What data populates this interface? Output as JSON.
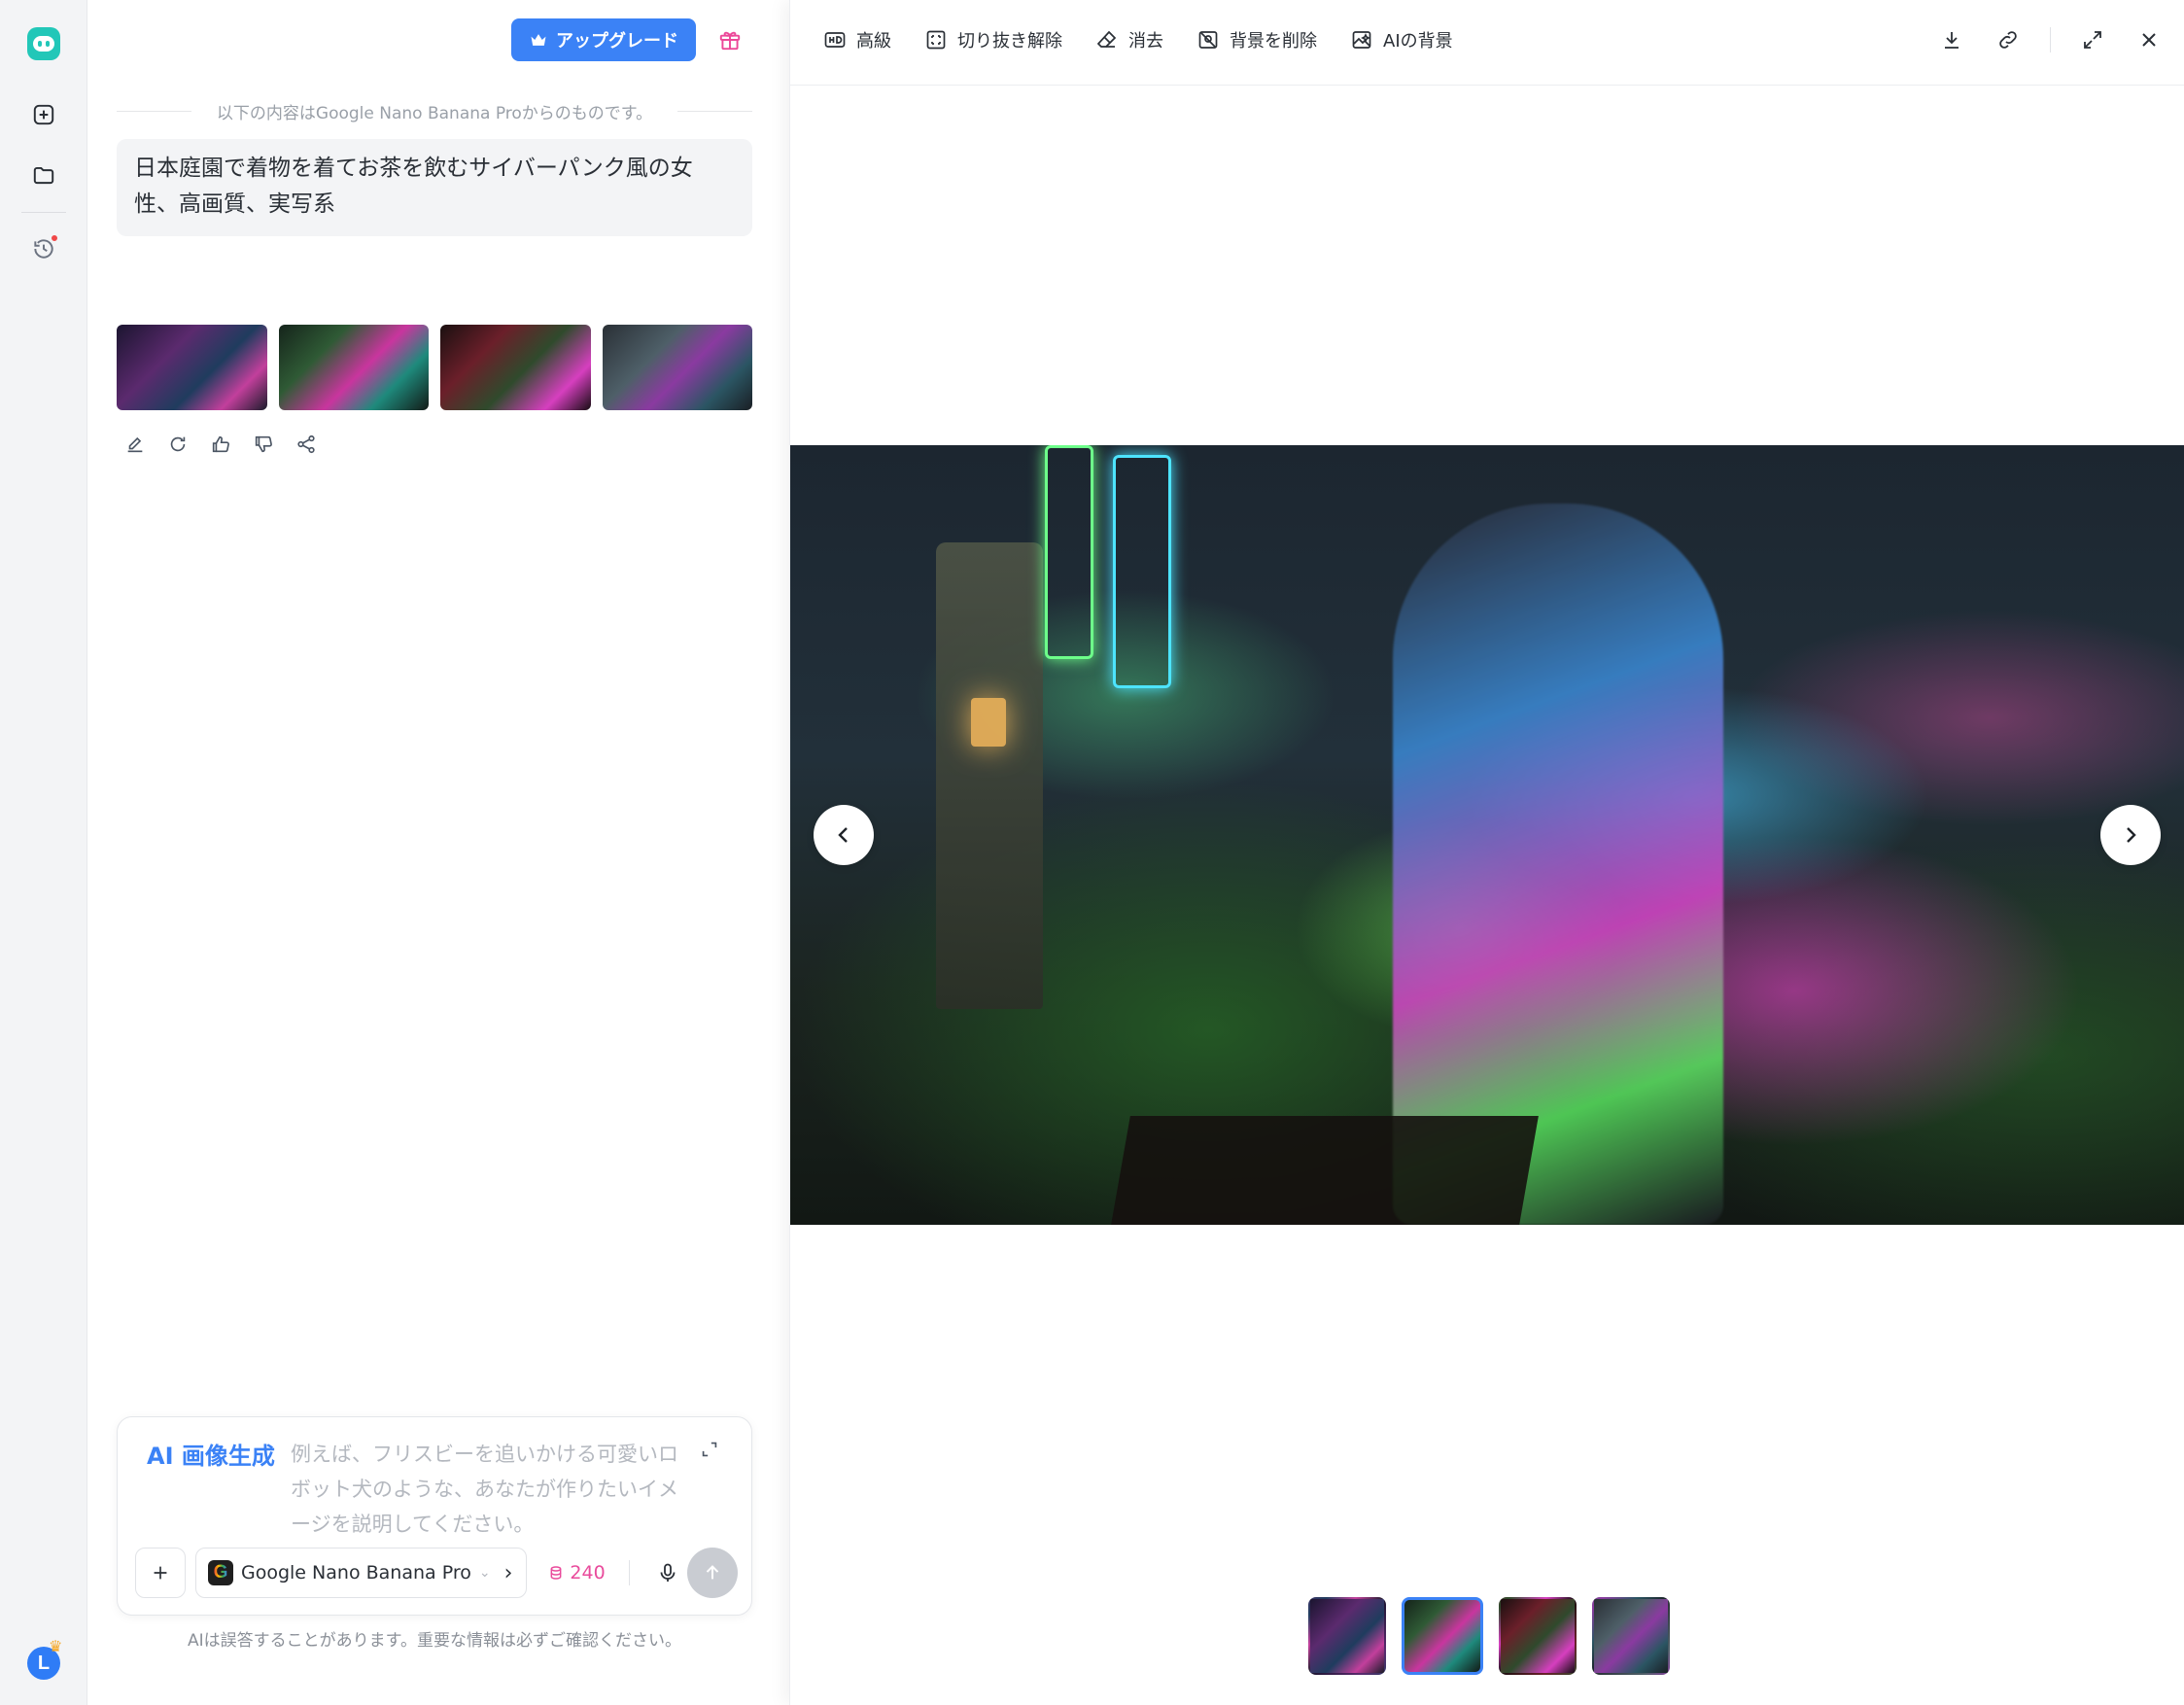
{
  "sidebar": {
    "logo_icon": "robot-face-icon",
    "items": [
      {
        "name": "new-chat",
        "icon": "plus-square-icon"
      },
      {
        "name": "files",
        "icon": "folder-icon"
      },
      {
        "name": "history",
        "icon": "history-clock-icon",
        "has_notification": true
      }
    ],
    "avatar_letter": "L"
  },
  "chat": {
    "upgrade_label": "アップグレード",
    "source_note": "以下の内容はGoogle Nano Banana Proからのものです。",
    "prompt": "日本庭園で着物を着てお茶を飲むサイバーパンク風の女性、高画質、実写系",
    "result_thumbnails": 4,
    "actions": [
      "edit",
      "regenerate",
      "like",
      "dislike",
      "share"
    ]
  },
  "composer": {
    "mode_label": "AI 画像生成",
    "placeholder": "例えば、フリスビーを追いかける可愛いロボット犬のような、あなたが作りたいイメージを説明してください。",
    "model_name": "Google Nano Banana Pro",
    "credits": "240",
    "disclaimer": "AIは誤答することがあります。重要な情報は必ずご確認ください。"
  },
  "viewer": {
    "tools": [
      {
        "label": "高級",
        "icon": "hd-icon"
      },
      {
        "label": "切り抜き解除",
        "icon": "uncrop-icon"
      },
      {
        "label": "消去",
        "icon": "eraser-icon"
      },
      {
        "label": "背景を削除",
        "icon": "remove-background-icon"
      },
      {
        "label": "AIの背景",
        "icon": "ai-background-icon"
      }
    ],
    "right_actions": [
      "download-icon",
      "link-icon",
      "expand-icon",
      "close-icon"
    ],
    "selected_index": 1,
    "thumbnail_count": 4
  },
  "colors": {
    "accent": "#3b82f6",
    "brand": "#22c7b8",
    "credits": "#e94b9c",
    "notification": "#f04848"
  }
}
